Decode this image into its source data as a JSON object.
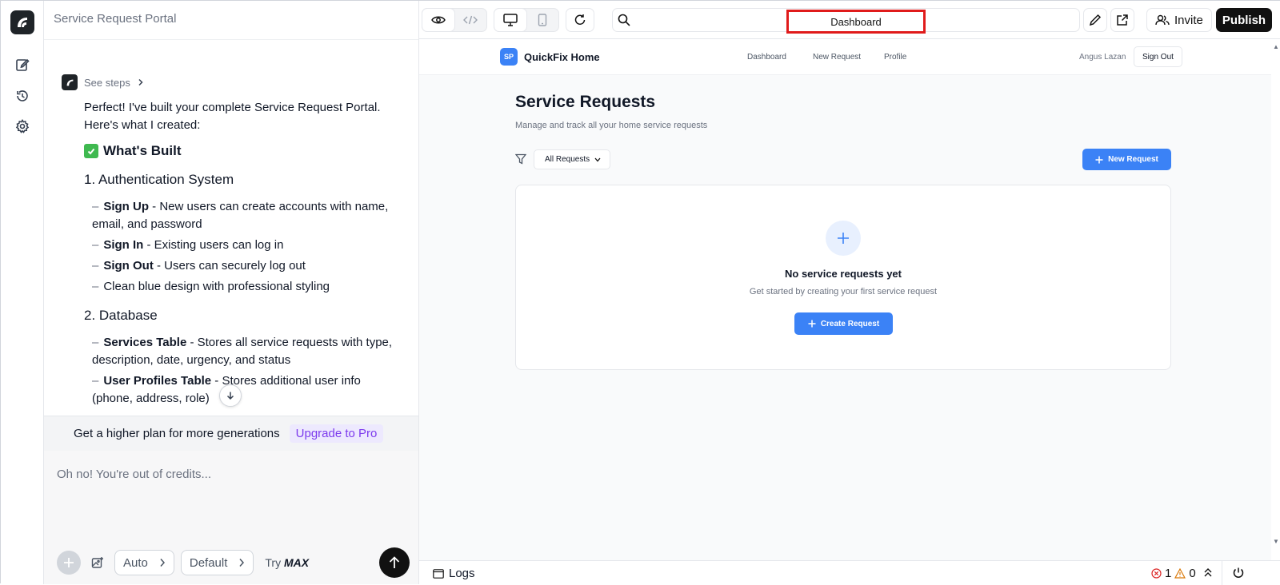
{
  "chat": {
    "title": "Service Request Portal",
    "see_steps": "See steps",
    "intro": "Perfect! I've built your complete Service Request Portal. Here's what I created:",
    "built_heading": "What's Built",
    "sections": [
      {
        "heading": "1. Authentication System",
        "items": [
          {
            "bold": "Sign Up",
            "text": " - New users can create accounts with name, email, and password"
          },
          {
            "bold": "Sign In",
            "text": " - Existing users can log in"
          },
          {
            "bold": "Sign Out",
            "text": " - Users can securely log out"
          },
          {
            "bold": "",
            "text": "Clean blue design with professional styling"
          }
        ]
      },
      {
        "heading": "2. Database",
        "items": [
          {
            "bold": "Services Table",
            "text": " - Stores all service requests with type, description, date, urgency, and status"
          },
          {
            "bold": "User Profiles Table",
            "text": " - Stores additional user info (phone, address, role)"
          }
        ]
      }
    ],
    "upgrade_text": "Get a higher plan for more generations",
    "upgrade_button": "Upgrade to Pro",
    "composer_placeholder": "Oh no! You're out of credits...",
    "mode_auto": "Auto",
    "mode_default": "Default",
    "try_label": "Try",
    "max_label": "MAX"
  },
  "toolbar": {
    "url": "Dashboard",
    "invite": "Invite",
    "publish": "Publish"
  },
  "site": {
    "brand_initials": "SP",
    "brand_name": "QuickFix Home",
    "nav": [
      "Dashboard",
      "New Request",
      "Profile"
    ],
    "user_name": "Angus Lazan",
    "sign_out": "Sign Out",
    "page_title": "Service Requests",
    "page_subtitle": "Manage and track all your home service requests",
    "filter_value": "All Requests",
    "new_request_button": "New Request",
    "empty_title": "No service requests yet",
    "empty_subtitle": "Get started by creating your first service request",
    "create_button": "Create Request"
  },
  "status": {
    "logs": "Logs",
    "errors": "1",
    "warnings": "0"
  },
  "colors": {
    "accent_blue": "#3b82f6",
    "highlight_red": "#e01b1b",
    "upgrade_purple": "#7c3aed"
  }
}
